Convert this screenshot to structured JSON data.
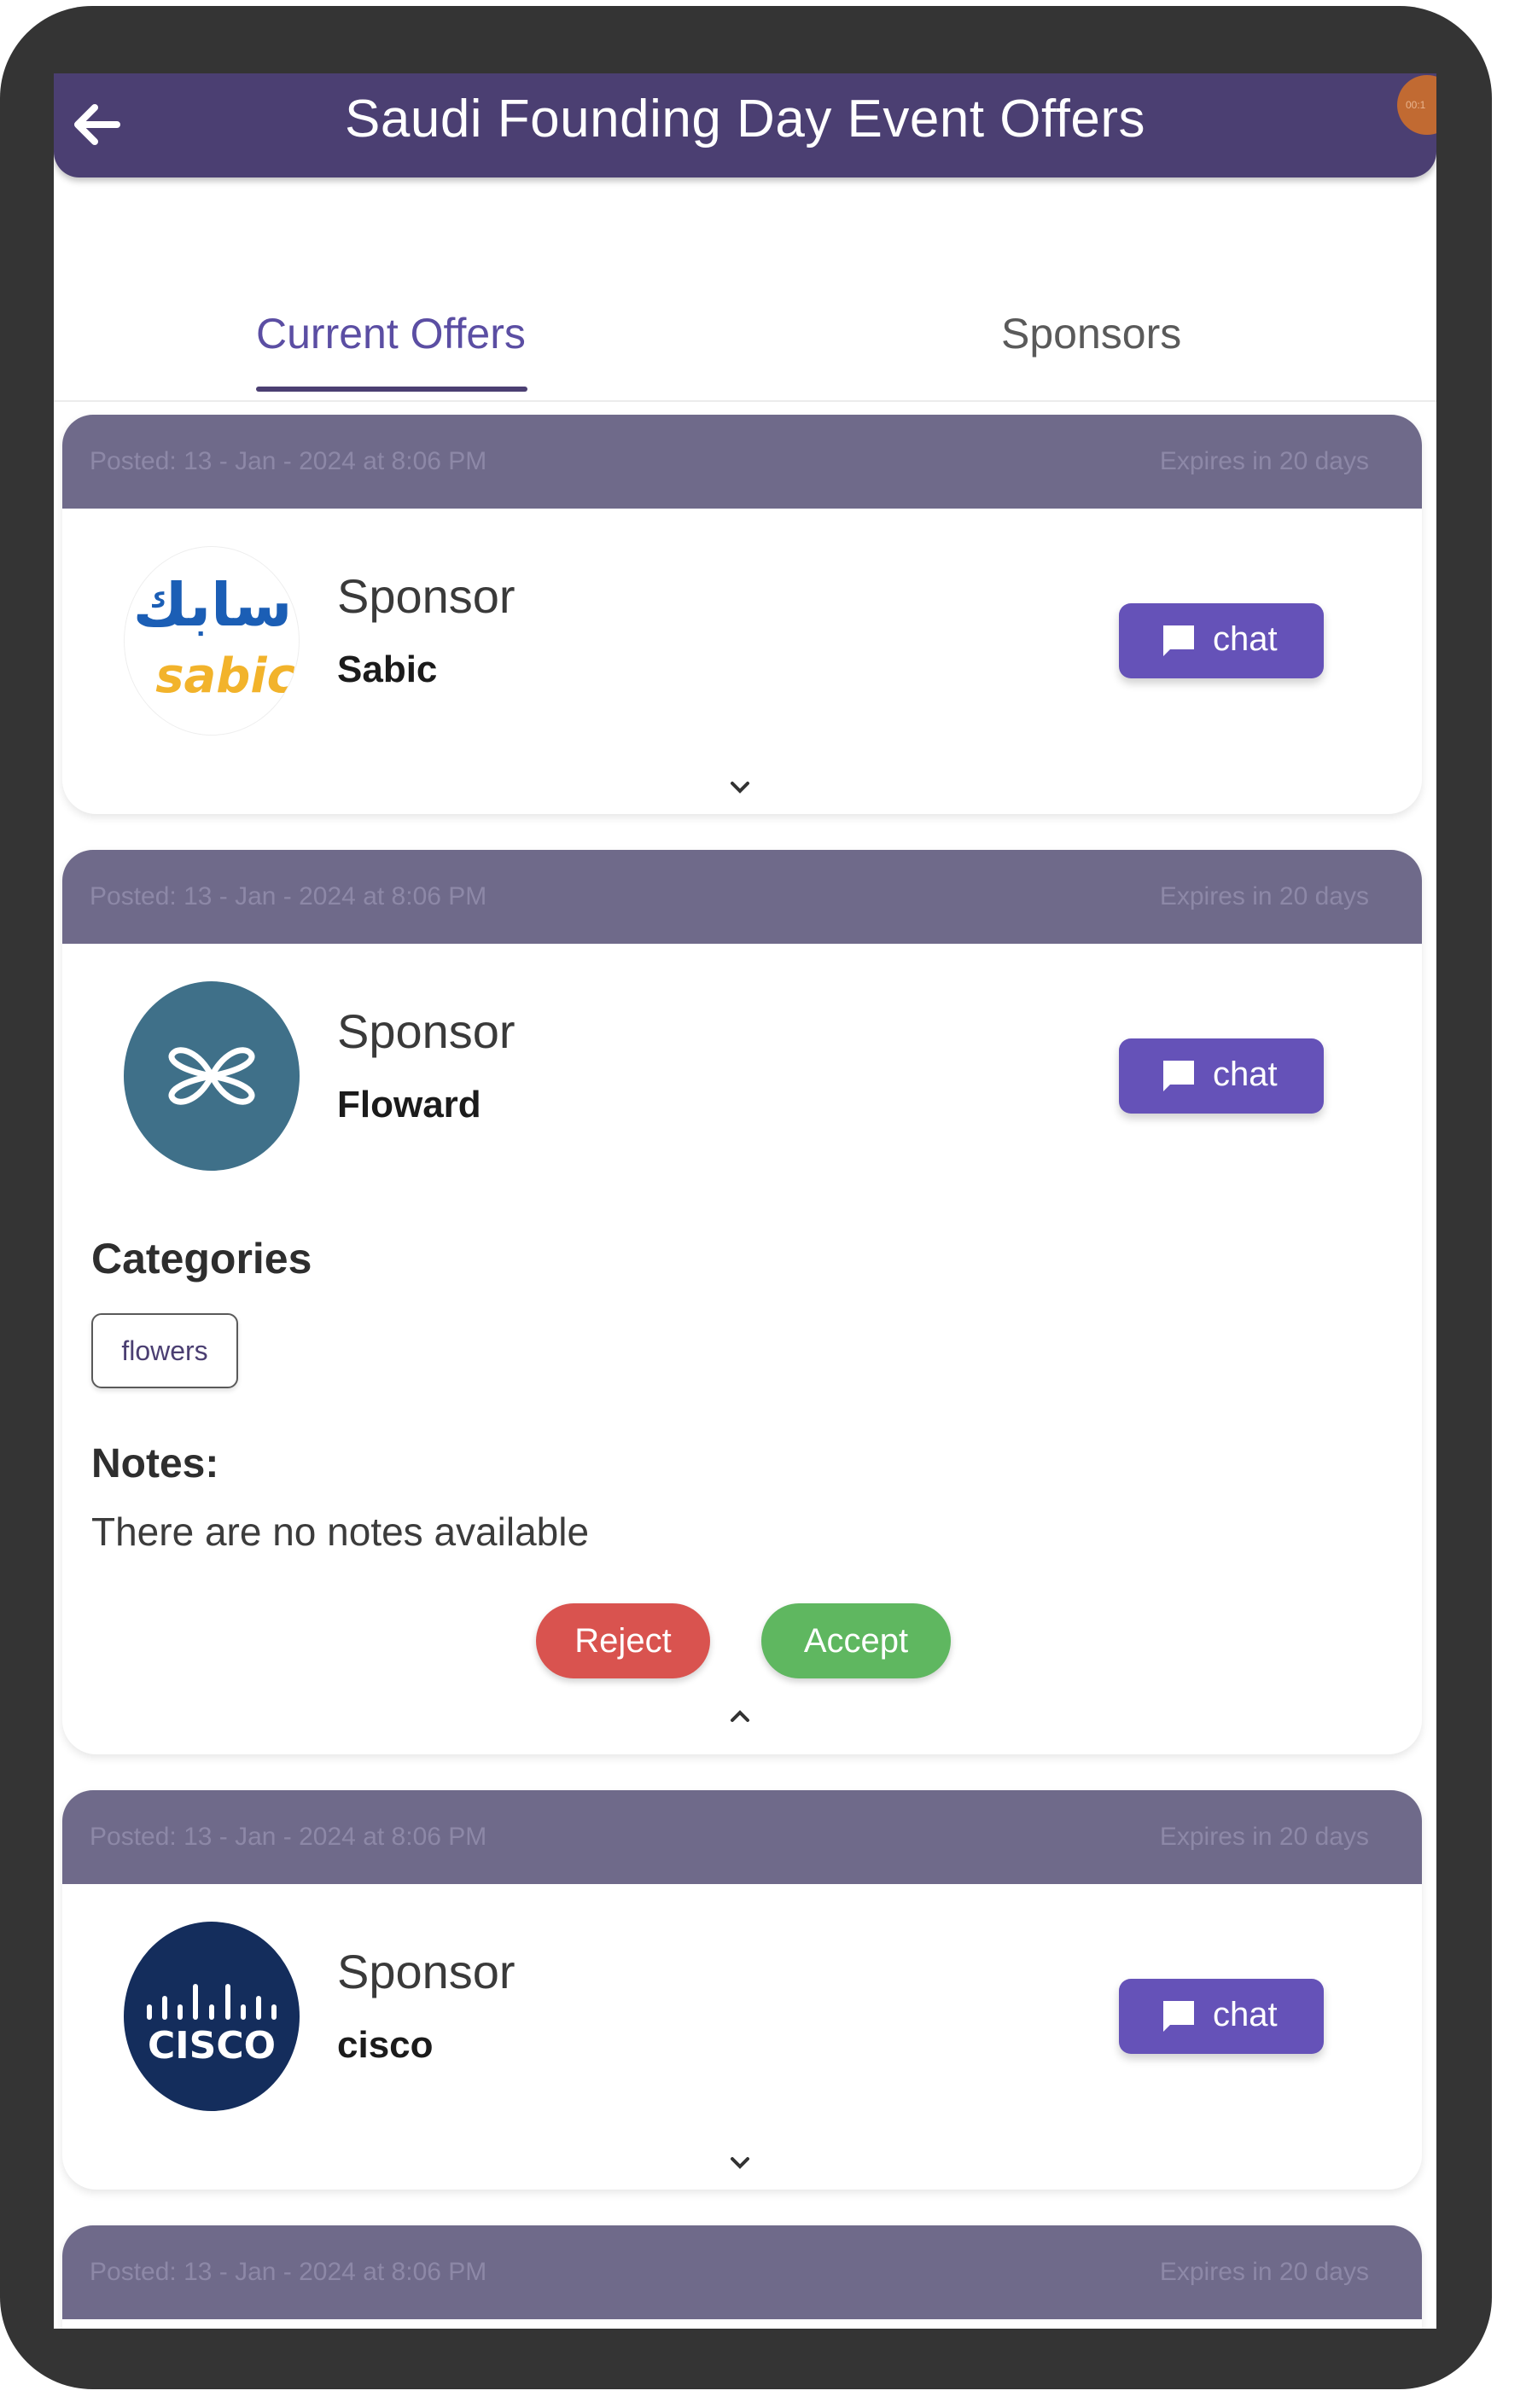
{
  "header": {
    "title": "Saudi Founding Day Event Offers",
    "back_icon": "arrow-left-icon",
    "rec_indicator": "00:1"
  },
  "tabs": [
    {
      "label": "Current Offers",
      "active": true
    },
    {
      "label": "Sponsors",
      "active": false
    }
  ],
  "offers": [
    {
      "posted": "Posted: 13 - Jan - 2024 at 8:06 PM",
      "expires": "Expires in 20 days",
      "sponsor_label": "Sponsor",
      "sponsor_name": "Sabic",
      "logo_text_ar": "سابك",
      "logo_text": "sabic",
      "chat_label": "chat",
      "expanded": false
    },
    {
      "posted": "Posted: 13 - Jan - 2024 at 8:06 PM",
      "expires": "Expires in 20 days",
      "sponsor_label": "Sponsor",
      "sponsor_name": "Floward",
      "chat_label": "chat",
      "expanded": true,
      "categories_title": "Categories",
      "categories": [
        "flowers"
      ],
      "notes_title": "Notes:",
      "notes_text": "There are no notes available",
      "reject_label": "Reject",
      "accept_label": "Accept"
    },
    {
      "posted": "Posted: 13 - Jan - 2024 at 8:06 PM",
      "expires": "Expires in 20 days",
      "sponsor_label": "Sponsor",
      "sponsor_name": "cisco",
      "logo_text": "CISCO",
      "chat_label": "chat",
      "expanded": false
    },
    {
      "posted": "Posted: 13 - Jan - 2024 at 8:06 PM",
      "expires": "Expires in 20 days"
    }
  ],
  "colors": {
    "header_bg": "#4b3f72",
    "card_header_bg": "#6f6a8a",
    "chat_button": "#6552b8",
    "reject": "#d9534f",
    "accept": "#5fb760",
    "floward_logo": "#3f7089",
    "cisco_logo": "#142d5c"
  }
}
